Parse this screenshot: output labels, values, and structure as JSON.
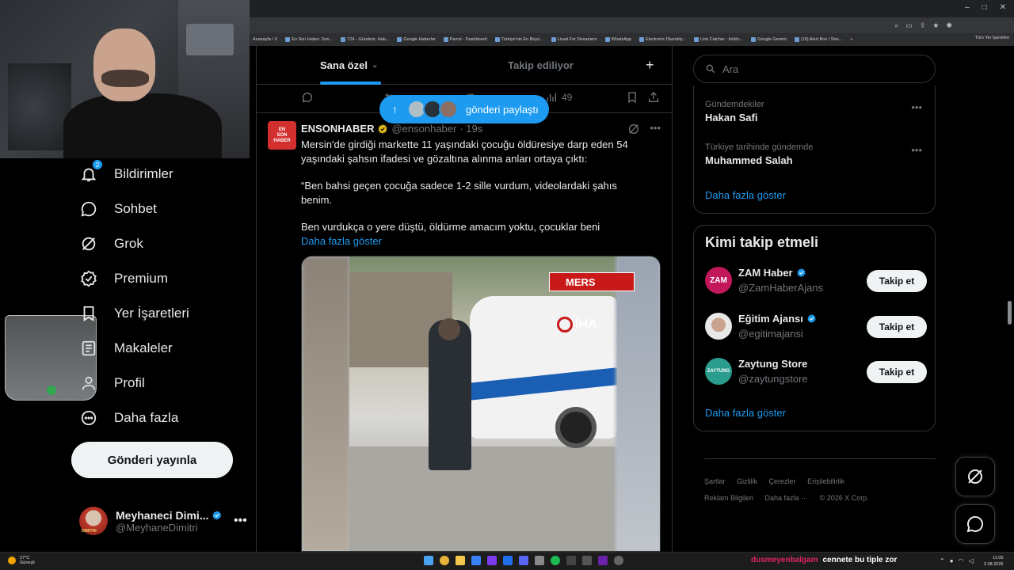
{
  "browser": {
    "window_controls": [
      "–",
      "□",
      "✕"
    ],
    "toolbar_icons": [
      "zoom-icon",
      "cast-icon",
      "share-icon",
      "star-icon",
      "extension-icon"
    ],
    "bookmarks": [
      "Anasayfa / X",
      "En Son Haber: Son...",
      "T24 - Gündem, Hab...",
      "Google Haberler",
      "Parrot - Dashboard",
      "Türkiye'nin En Büyü...",
      "Livad For Streamers",
      "WhatsApp",
      "Electronic Diversity...",
      "Link Catcher - kicklo...",
      "Google Gemini",
      "(19) Alert Box / Stre..."
    ],
    "bookmarks_more": "»",
    "all_bookmarks": "Tüm Yer İşaretleri"
  },
  "nav": {
    "items": [
      {
        "label": "Bildirimler",
        "icon": "bell-icon",
        "badge": "2"
      },
      {
        "label": "Sohbet",
        "icon": "chat-icon"
      },
      {
        "label": "Grok",
        "icon": "grok-icon"
      },
      {
        "label": "Premium",
        "icon": "premium-check-icon"
      },
      {
        "label": "Yer İşaretleri",
        "icon": "bookmark-icon"
      },
      {
        "label": "Makaleler",
        "icon": "article-icon"
      },
      {
        "label": "Profil",
        "icon": "person-icon"
      },
      {
        "label": "Daha fazla",
        "icon": "more-circle-icon"
      }
    ],
    "post_button": "Gönderi yayınla",
    "profile": {
      "name": "Meyhaneci Dimi...",
      "handle": "@MeyhaneDimitri",
      "more": "•••"
    }
  },
  "timeline": {
    "tabs": [
      {
        "label": "Sana özel",
        "active": true
      },
      {
        "label": "Takip ediliyor",
        "active": false
      }
    ],
    "add_tab": "+",
    "action_row": {
      "views": "49"
    },
    "toast": {
      "label": "gönderi paylaştı"
    },
    "tweet": {
      "avatar_lines": [
        "EN",
        "SON",
        "HABER"
      ],
      "name": "ENSONHABER",
      "handle": "@ensonhaber",
      "time": "· 19s",
      "paragraphs": [
        "Mersin'de girdiği markette 11 yaşındaki çocuğu öldüresiye darp eden 54 yaşındaki şahsın ifadesi ve gözaltına alınma anları ortaya çıktı:",
        "“Ben bahsi geçen çocuğa sadece 1-2 sille vurdum, videolardaki şahıs benim.",
        "Ben vurdukça o yere düştü, öldürme amacım yoktu, çocuklar beni"
      ],
      "show_more": "Daha fazla göster",
      "media": {
        "overlay_banner": "MERS",
        "overlay_logo": "İHA"
      }
    }
  },
  "sidebar": {
    "search_placeholder": "Ara",
    "trends": [
      {
        "category": "Gündemdekiler",
        "title": "Hakan Safi"
      },
      {
        "category": "Türkiye tarihinde gündemde",
        "title": "Muhammed Salah"
      }
    ],
    "trends_more": "Daha fazla göster",
    "follow": {
      "title": "Kimi takip etmeli",
      "accounts": [
        {
          "name": "ZAM Haber",
          "handle": "@ZamHaberAjans",
          "button": "Takip et",
          "avatar_text": "ZAM",
          "color": "#c2185b"
        },
        {
          "name": "Eğitim Ajansı",
          "handle": "@egitimajansi",
          "button": "Takip et",
          "avatar_text": "",
          "color": "#e0e0e0"
        },
        {
          "name": "Zaytung Store",
          "handle": "@zaytungstore",
          "button": "Takip et",
          "avatar_text": "ZAYTUNG",
          "color": "#2a9d8f"
        }
      ],
      "more": "Daha fazla göster"
    },
    "footer": {
      "line1": [
        "Şartlar",
        "Gizlilik",
        "Çerezler",
        "Erişilebilirlik"
      ],
      "line2": [
        "Reklam Bilgileri",
        "Daha fazla ···",
        "© 2026 X Corp."
      ]
    }
  },
  "taskbar": {
    "weather_temp": "27°C",
    "weather_desc": "Güneşli",
    "ticker_user": "dusmeyenbalgam",
    "ticker_msg": "cennete bu tiple zor",
    "time": "11:05",
    "date": "2.08.2026"
  },
  "colors": {
    "accent": "#1d9bf0",
    "background": "#000000",
    "border": "#2f3336",
    "muted": "#71767b"
  }
}
